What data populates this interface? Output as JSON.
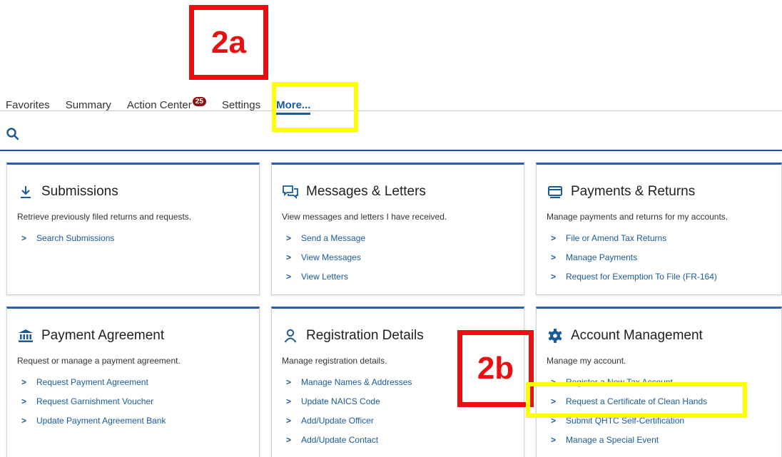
{
  "tabs": [
    {
      "label": "Favorites"
    },
    {
      "label": "Summary"
    },
    {
      "label": "Action Center",
      "badge": "25"
    },
    {
      "label": "Settings"
    },
    {
      "label": "More..."
    }
  ],
  "search": {
    "icon": "search-icon"
  },
  "cards": [
    {
      "title": "Submissions",
      "icon": "download-icon",
      "description": "Retrieve previously filed returns and requests.",
      "links": [
        "Search Submissions"
      ]
    },
    {
      "title": "Messages & Letters",
      "icon": "chat-icon",
      "description": "View messages and letters I have received.",
      "links": [
        "Send a Message",
        "View Messages",
        "View Letters"
      ]
    },
    {
      "title": "Payments & Returns",
      "icon": "payments-icon",
      "description": "Manage payments and returns for my accounts.",
      "links": [
        "File or Amend Tax Returns",
        "Manage Payments",
        "Request for Exemption To File (FR-164)"
      ]
    },
    {
      "title": "Payment Agreement",
      "icon": "bank-icon",
      "description": "Request or manage a payment agreement.",
      "links": [
        "Request Payment Agreement",
        "Request Garnishment Voucher",
        "Update Payment Agreement Bank"
      ]
    },
    {
      "title": "Registration Details",
      "icon": "person-icon",
      "description": "Manage registration details.",
      "links": [
        "Manage Names & Addresses",
        "Update NAICS Code",
        "Add/Update Officer",
        "Add/Update Contact"
      ]
    },
    {
      "title": "Account Management",
      "icon": "gear-icon",
      "description": "Manage my account.",
      "links": [
        "Register a New Tax Account",
        "Request a Certificate of Clean Hands",
        "Submit QHTC Self-Certification",
        "Manage a Special Event"
      ]
    }
  ],
  "annotations": {
    "label_a": "2a",
    "label_b": "2b",
    "red": "#e81010",
    "yellow": "#ffff00"
  }
}
